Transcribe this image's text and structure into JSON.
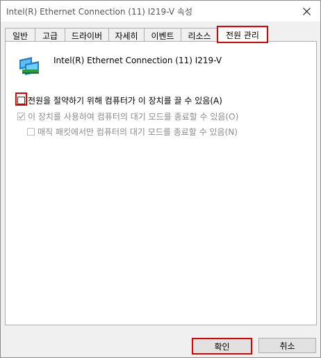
{
  "window": {
    "title": "Intel(R) Ethernet Connection (11) I219-V 속성"
  },
  "tabs": [
    {
      "label": "일반"
    },
    {
      "label": "고급"
    },
    {
      "label": "드라이버"
    },
    {
      "label": "자세히"
    },
    {
      "label": "이벤트"
    },
    {
      "label": "리소스"
    },
    {
      "label": "전원 관리",
      "active": true
    }
  ],
  "device": {
    "name": "Intel(R) Ethernet Connection (11) I219-V",
    "icon": "network-adapter-icon"
  },
  "options": {
    "allow_turn_off": {
      "label": "전원을 절약하기 위해 컴퓨터가 이 장치를 끌 수 있음(A)",
      "checked": false,
      "enabled": true
    },
    "allow_wake": {
      "label": "이 장치를 사용하여 컴퓨터의 대기 모드를 종료할 수 있음(O)",
      "checked": true,
      "enabled": false
    },
    "magic_packet_only": {
      "label": "매직 패킷에서만 컴퓨터의 대기 모드를 종료할 수 있음(N)",
      "checked": false,
      "enabled": false
    }
  },
  "buttons": {
    "ok": "확인",
    "cancel": "취소"
  },
  "colors": {
    "highlight": "#e00000",
    "disabled_text": "#8b8b8b"
  }
}
